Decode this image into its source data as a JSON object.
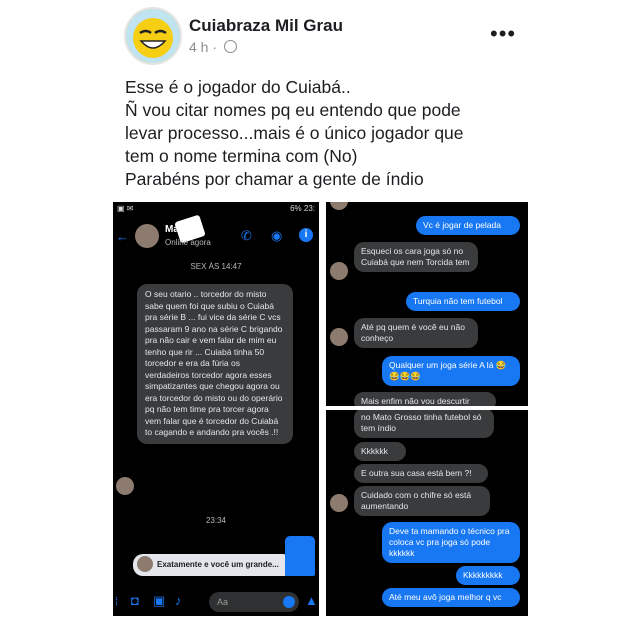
{
  "post": {
    "page_name": "Cuiabraza Mil Grau",
    "time": "4 h ·",
    "more_label": "•••",
    "caption_lines": [
      "Esse é o jogador do Cuiabá..",
      "Ñ vou citar nomes pq eu entendo que pode",
      "levar processo...mais é o único jogador que",
      "tem o nome termina com (No)",
      "Parabéns por chamar a gente de índio"
    ]
  },
  "screenshot1": {
    "status_right": "6% 23:",
    "contact_name": "Ma",
    "contact_status": "Online agora",
    "date_stamp": "SEX ÀS 14:47",
    "long_message": "O seu otario .. torcedor do misto sabe quem foi que subiu o Cuiabá pra série B ... fui vice da série C vcs passaram 9 ano na série C brigando pra não cair e vem falar de mim eu tenho que rir ... Cuiabá tinha 50 torcedor e era da fúria os verdadeiros torcedor agora esses simpatizantes que chegou agora ou era torcedor do misto ou do operário pq não tem time pra torcer agora vem falar que é torcedor do Cuiabá to cagando e andando pra vocês .!!",
    "time_stamp": "23:34",
    "preview_message": "Exatamente e você um grande...",
    "composer_placeholder": "Aa"
  },
  "screenshot2": {
    "messages": [
      {
        "from": "me",
        "text": "Vc é jogar de pelada"
      },
      {
        "from": "them",
        "text": "Esqueci os cara joga só no Cuiabá que nem Torcida tem"
      },
      {
        "from": "me",
        "text": "Turquia não tem futebol"
      },
      {
        "from": "them",
        "text": "Até pq quem é você eu não conheço"
      },
      {
        "from": "me",
        "text": "Qualquer um joga série A lá 😂😂😂😂"
      },
      {
        "from": "them",
        "text": "Mais enfim não vou descurtir"
      }
    ]
  },
  "screenshot3": {
    "messages": [
      {
        "from": "them",
        "text": "no Mato Grosso tinha futebol só tem índio"
      },
      {
        "from": "them",
        "text": "Kkkkkk"
      },
      {
        "from": "them",
        "text": "E outra sua casa está bem ?!"
      },
      {
        "from": "them",
        "text": "Cuidado com o chifre só está aumentando"
      },
      {
        "from": "me",
        "text": "Deve ta mamando o técnico pra coloca vc pra joga só pode kkkkkk"
      },
      {
        "from": "me",
        "text": "Kkkkkkkkk"
      },
      {
        "from": "me",
        "text": "Até meu avô joga melhor q vc"
      }
    ]
  },
  "colors": {
    "accent": "#1877f2",
    "chat_background": "#000000",
    "incoming_bubble": "#3a3b3c"
  },
  "icons": [
    "emoji-avatar-icon",
    "globe-icon",
    "back-arrow-icon",
    "phone-icon",
    "video-icon",
    "info-icon",
    "camera-icon",
    "image-icon",
    "mic-icon",
    "emoji-icon",
    "like-icon"
  ]
}
